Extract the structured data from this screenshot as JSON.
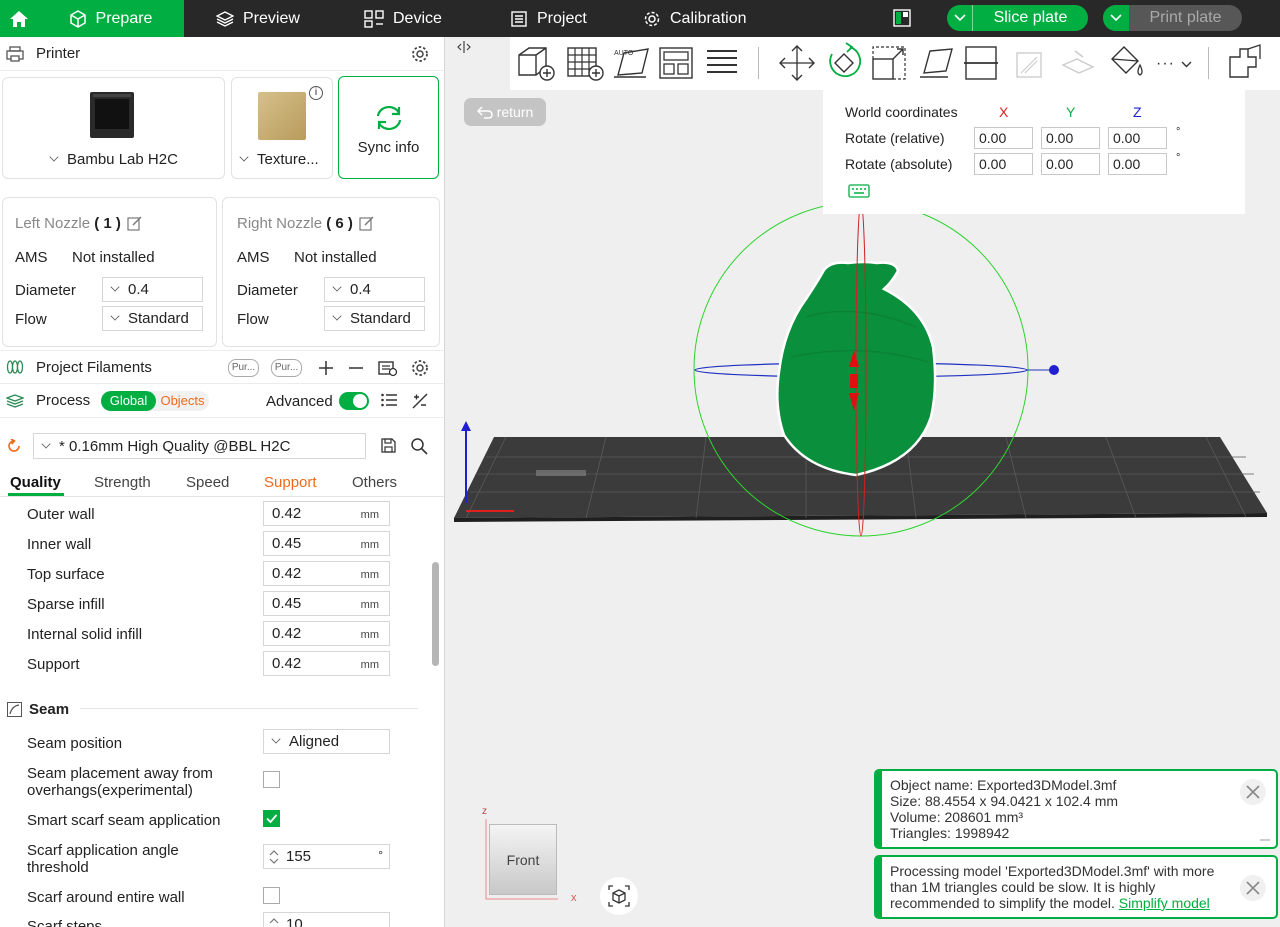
{
  "tabs": [
    {
      "label": "Prepare",
      "icon": "cube-icon"
    },
    {
      "label": "Preview",
      "icon": "layers-icon"
    },
    {
      "label": "Device",
      "icon": "device-icon"
    },
    {
      "label": "Project",
      "icon": "project-icon"
    },
    {
      "label": "Calibration",
      "icon": "calibration-icon"
    }
  ],
  "actions": {
    "slice": "Slice plate",
    "print": "Print plate"
  },
  "printer": {
    "section_title": "Printer",
    "name": "Bambu Lab H2C",
    "plate": "Texture...",
    "sync": "Sync info",
    "left_nozzle": {
      "label": "Left Nozzle",
      "num": "1",
      "ams_label": "AMS",
      "ams": "Not installed",
      "diameter_label": "Diameter",
      "diameter": "0.4",
      "flow_label": "Flow",
      "flow": "Standard"
    },
    "right_nozzle": {
      "label": "Right Nozzle",
      "num": "6",
      "ams_label": "AMS",
      "ams": "Not installed",
      "diameter_label": "Diameter",
      "diameter": "0.4",
      "flow_label": "Flow",
      "flow": "Standard"
    }
  },
  "filaments": {
    "title": "Project Filaments",
    "chip1": "Pur...",
    "chip2": "Pur..."
  },
  "process": {
    "title": "Process",
    "global": "Global",
    "objects": "Objects",
    "advanced": "Advanced",
    "advanced_on": true,
    "preset": "* 0.16mm High Quality @BBL H2C",
    "subtabs": [
      "Quality",
      "Strength",
      "Speed",
      "Support",
      "Others"
    ],
    "line_widths": [
      {
        "label": "Outer wall",
        "value": "0.42",
        "unit": "mm"
      },
      {
        "label": "Inner wall",
        "value": "0.45",
        "unit": "mm"
      },
      {
        "label": "Top surface",
        "value": "0.42",
        "unit": "mm"
      },
      {
        "label": "Sparse infill",
        "value": "0.45",
        "unit": "mm"
      },
      {
        "label": "Internal solid infill",
        "value": "0.42",
        "unit": "mm"
      },
      {
        "label": "Support",
        "value": "0.42",
        "unit": "mm"
      }
    ],
    "seam": {
      "title": "Seam",
      "position_label": "Seam position",
      "position": "Aligned",
      "away_label_1": "Seam placement away from",
      "away_label_2": "overhangs(experimental)",
      "away_checked": false,
      "smart_label": "Smart scarf seam application",
      "smart_checked": true,
      "angle_label_1": "Scarf application angle",
      "angle_label_2": "threshold",
      "angle": "155",
      "angle_unit": "°",
      "entire_label": "Scarf around entire wall",
      "entire_checked": false,
      "steps_label": "Scarf steps",
      "steps": "10"
    }
  },
  "viewport": {
    "return": "return",
    "rotate": {
      "header": "World coordinates",
      "axes": [
        "X",
        "Y",
        "Z"
      ],
      "relative_label": "Rotate (relative)",
      "relative": [
        "0.00",
        "0.00",
        "0.00"
      ],
      "absolute_label": "Rotate (absolute)",
      "absolute": [
        "0.00",
        "0.00",
        "0.00"
      ],
      "unit": "°"
    },
    "cube_label": "Front",
    "axis_z": "z",
    "axis_x": "x",
    "colors": {
      "x": "#e02020",
      "y": "#1aa84a",
      "z": "#2020d0",
      "model": "#0a8f3c",
      "accent": "#00ae42"
    }
  },
  "notices": [
    {
      "lines": [
        "Object name: Exported3DModel.3mf",
        "Size: 88.4554 x 94.0421 x 102.4 mm",
        "Volume: 208601 mm³",
        "Triangles: 1998942"
      ]
    },
    {
      "lines": [
        "Processing model 'Exported3DModel.3mf' with more",
        "than 1M triangles could be slow. It is highly",
        "recommended to simplify the model."
      ],
      "link": "Simplify model"
    }
  ]
}
